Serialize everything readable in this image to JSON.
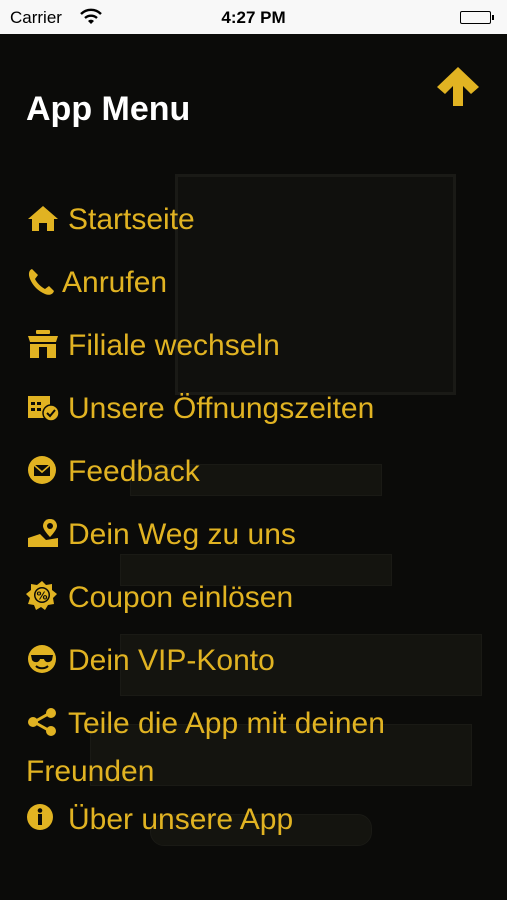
{
  "status_bar": {
    "carrier": "Carrier",
    "time": "4:27 PM"
  },
  "menu": {
    "title": "App Menu",
    "accent_color": "#e1b322",
    "items": [
      {
        "label": "Startseite",
        "icon": "home-icon"
      },
      {
        "label": "Anrufen",
        "icon": "phone-icon"
      },
      {
        "label": "Filiale wechseln",
        "icon": "store-icon"
      },
      {
        "label": "Unsere Öffnungszeiten",
        "icon": "calendar-check-icon"
      },
      {
        "label": "Feedback",
        "icon": "envelope-circle-icon"
      },
      {
        "label": "Dein Weg zu uns",
        "icon": "map-pin-icon"
      },
      {
        "label": "Coupon einlösen",
        "icon": "percent-badge-icon"
      },
      {
        "label": "Dein VIP-Konto",
        "icon": "sunglasses-icon"
      },
      {
        "label": "Teile die App mit deinen Freunden",
        "icon": "share-icon"
      },
      {
        "label": "Über unsere App",
        "icon": "info-icon"
      }
    ]
  }
}
